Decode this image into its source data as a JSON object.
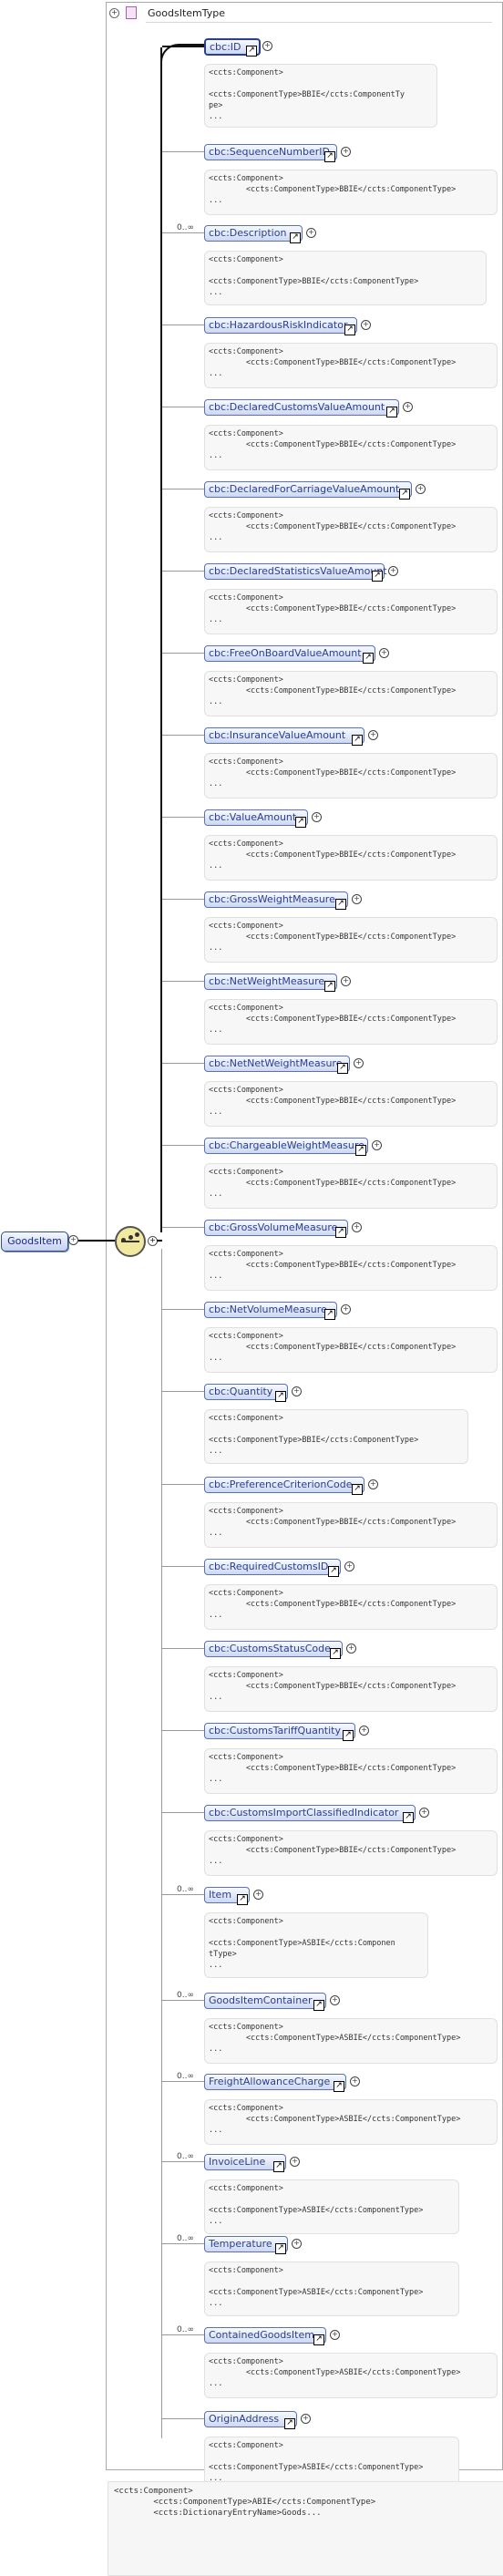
{
  "type_title": "GoodsItemType",
  "root_label": "GoodsItem",
  "expand_glyph": "+",
  "ref_glyph": "↗",
  "multiplicity": "0..∞",
  "elements": [
    {
      "name": "cbc:ID",
      "multi": "",
      "note": "<ccts:Component>\n\n<ccts:ComponentType>BBIE</ccts:ComponentTy\npe>\n..."
    },
    {
      "name": "cbc:SequenceNumberID",
      "multi": "",
      "note": "<ccts:Component>\n        <ccts:ComponentType>BBIE</ccts:ComponentType>\n..."
    },
    {
      "name": "cbc:Description",
      "multi": "0..∞",
      "note": "<ccts:Component>\n\n<ccts:ComponentType>BBIE</ccts:ComponentType>\n..."
    },
    {
      "name": "cbc:HazardousRiskIndicator",
      "multi": "",
      "note": "<ccts:Component>\n        <ccts:ComponentType>BBIE</ccts:ComponentType>\n..."
    },
    {
      "name": "cbc:DeclaredCustomsValueAmount",
      "multi": "",
      "note": "<ccts:Component>\n        <ccts:ComponentType>BBIE</ccts:ComponentType>\n..."
    },
    {
      "name": "cbc:DeclaredForCarriageValueAmount",
      "multi": "",
      "note": "<ccts:Component>\n        <ccts:ComponentType>BBIE</ccts:ComponentType>\n..."
    },
    {
      "name": "cbc:DeclaredStatisticsValueAmount",
      "multi": "",
      "note": "<ccts:Component>\n        <ccts:ComponentType>BBIE</ccts:ComponentType>\n..."
    },
    {
      "name": "cbc:FreeOnBoardValueAmount",
      "multi": "",
      "note": "<ccts:Component>\n        <ccts:ComponentType>BBIE</ccts:ComponentType>\n..."
    },
    {
      "name": "cbc:InsuranceValueAmount",
      "multi": "",
      "note": "<ccts:Component>\n        <ccts:ComponentType>BBIE</ccts:ComponentType>\n..."
    },
    {
      "name": "cbc:ValueAmount",
      "multi": "",
      "note": "<ccts:Component>\n        <ccts:ComponentType>BBIE</ccts:ComponentType>\n..."
    },
    {
      "name": "cbc:GrossWeightMeasure",
      "multi": "",
      "note": "<ccts:Component>\n        <ccts:ComponentType>BBIE</ccts:ComponentType>\n..."
    },
    {
      "name": "cbc:NetWeightMeasure",
      "multi": "",
      "note": "<ccts:Component>\n        <ccts:ComponentType>BBIE</ccts:ComponentType>\n..."
    },
    {
      "name": "cbc:NetNetWeightMeasure",
      "multi": "",
      "note": "<ccts:Component>\n        <ccts:ComponentType>BBIE</ccts:ComponentType>\n..."
    },
    {
      "name": "cbc:ChargeableWeightMeasure",
      "multi": "",
      "note": "<ccts:Component>\n        <ccts:ComponentType>BBIE</ccts:ComponentType>\n..."
    },
    {
      "name": "cbc:GrossVolumeMeasure",
      "multi": "",
      "note": "<ccts:Component>\n        <ccts:ComponentType>BBIE</ccts:ComponentType>\n..."
    },
    {
      "name": "cbc:NetVolumeMeasure",
      "multi": "",
      "note": "<ccts:Component>\n        <ccts:ComponentType>BBIE</ccts:ComponentType>\n..."
    },
    {
      "name": "cbc:Quantity",
      "multi": "",
      "note": "<ccts:Component>\n\n<ccts:ComponentType>BBIE</ccts:ComponentType>\n..."
    },
    {
      "name": "cbc:PreferenceCriterionCode",
      "multi": "",
      "note": "<ccts:Component>\n        <ccts:ComponentType>BBIE</ccts:ComponentType>\n..."
    },
    {
      "name": "cbc:RequiredCustomsID",
      "multi": "",
      "note": "<ccts:Component>\n        <ccts:ComponentType>BBIE</ccts:ComponentType>\n..."
    },
    {
      "name": "cbc:CustomsStatusCode",
      "multi": "",
      "note": "<ccts:Component>\n        <ccts:ComponentType>BBIE</ccts:ComponentType>\n..."
    },
    {
      "name": "cbc:CustomsTariffQuantity",
      "multi": "",
      "note": "<ccts:Component>\n        <ccts:ComponentType>BBIE</ccts:ComponentType>\n..."
    },
    {
      "name": "cbc:CustomsImportClassifiedIndicator",
      "multi": "",
      "note": "<ccts:Component>\n        <ccts:ComponentType>BBIE</ccts:ComponentType>\n..."
    },
    {
      "name": "Item",
      "multi": "0..∞",
      "note": "<ccts:Component>\n\n<ccts:ComponentType>ASBIE</ccts:Componen\ntType>\n..."
    },
    {
      "name": "GoodsItemContainer",
      "multi": "0..∞",
      "note": "<ccts:Component>\n        <ccts:ComponentType>ASBIE</ccts:ComponentType>\n..."
    },
    {
      "name": "FreightAllowanceCharge",
      "multi": "0..∞",
      "note": "<ccts:Component>\n        <ccts:ComponentType>ASBIE</ccts:ComponentType>\n..."
    },
    {
      "name": "InvoiceLine",
      "multi": "0..∞",
      "note": "<ccts:Component>\n\n<ccts:ComponentType>ASBIE</ccts:ComponentType>\n..."
    },
    {
      "name": "Temperature",
      "multi": "0..∞",
      "note": "<ccts:Component>\n\n<ccts:ComponentType>ASBIE</ccts:ComponentType>\n..."
    },
    {
      "name": "ContainedGoodsItem",
      "multi": "0..∞",
      "note": "<ccts:Component>\n        <ccts:ComponentType>ASBIE</ccts:ComponentType>\n..."
    },
    {
      "name": "OriginAddress",
      "multi": "",
      "note": "<ccts:Component>\n\n<ccts:ComponentType>ASBIE</ccts:ComponentType>\n..."
    }
  ],
  "bottom_note": "<ccts:Component>\n        <ccts:ComponentType>ABIE</ccts:ComponentType>\n        <ccts:DictionaryEntryName>Goods..."
}
